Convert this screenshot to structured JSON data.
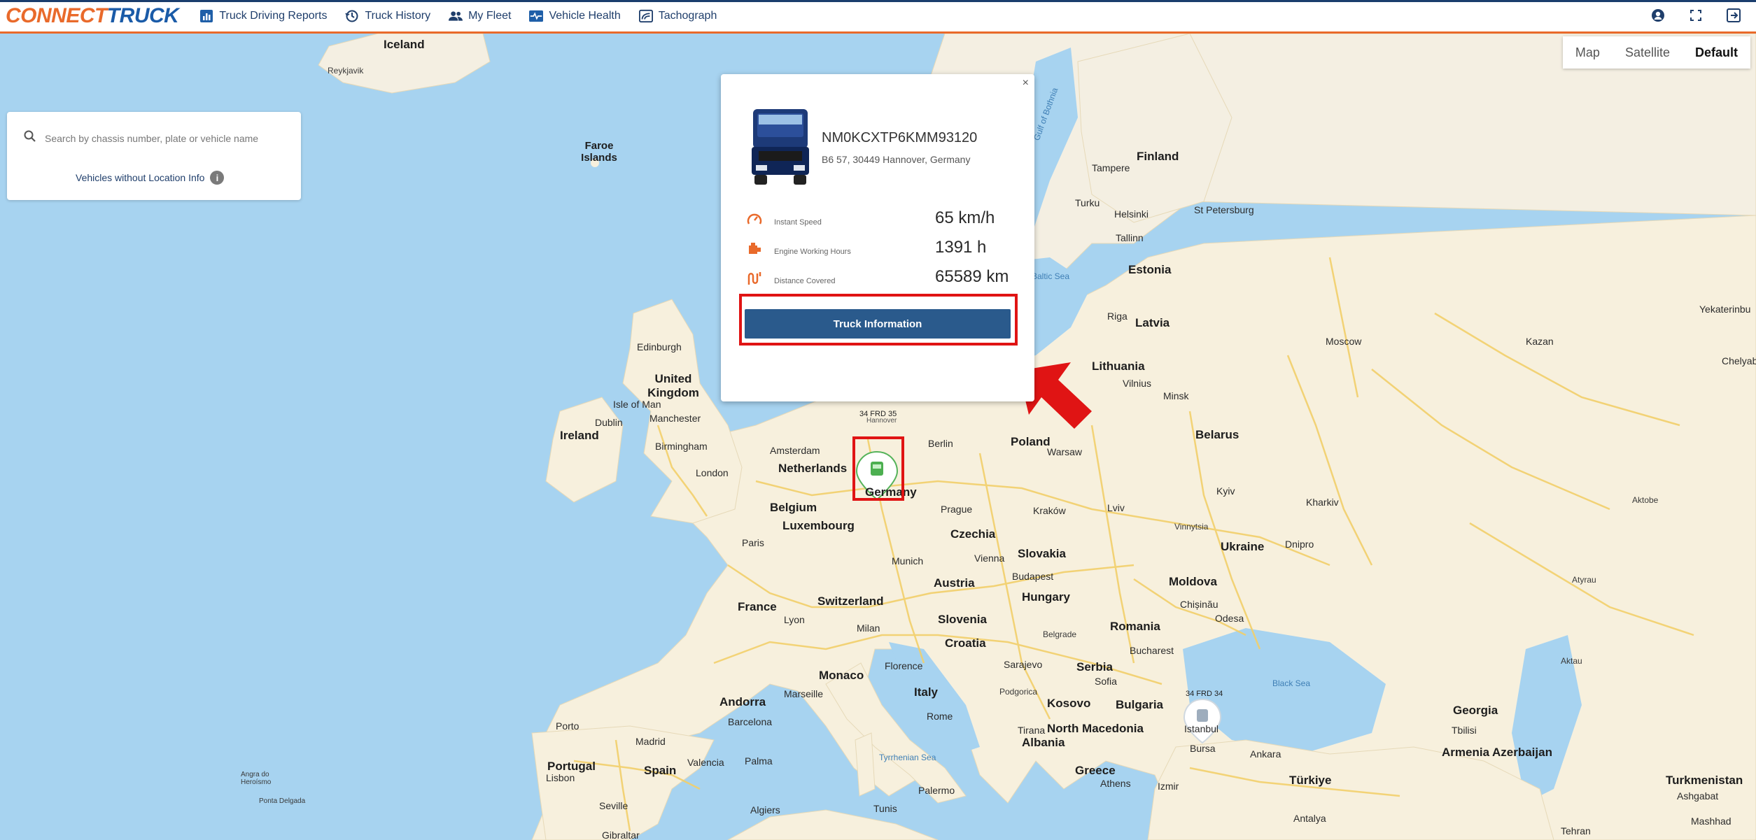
{
  "header": {
    "logo_prefix": "CONNECT",
    "logo_suffix": "RUCK",
    "logo_t": "T",
    "nav": [
      {
        "label": "Truck Driving Reports",
        "icon": "bar-chart-icon"
      },
      {
        "label": "Truck History",
        "icon": "history-icon"
      },
      {
        "label": "My Fleet",
        "icon": "users-icon"
      },
      {
        "label": "Vehicle Health",
        "icon": "heartbeat-icon"
      },
      {
        "label": "Tachograph",
        "icon": "tachograph-icon"
      }
    ],
    "right_icons": [
      "user-icon",
      "fullscreen-icon",
      "logout-icon"
    ]
  },
  "map_type": {
    "options": [
      "Map",
      "Satellite",
      "Default"
    ],
    "selected": "Default"
  },
  "search": {
    "placeholder": "Search by chassis number, plate or vehicle name",
    "value": "",
    "no_location_label": "Vehicles without Location Info"
  },
  "popup": {
    "vin": "NM0KCXTP6KMM93120",
    "address": "B6 57, 30449 Hannover, Germany",
    "stats": [
      {
        "label": "Instant Speed",
        "value": "65 km/h",
        "icon": "speedometer-icon"
      },
      {
        "label": "Engine Working Hours",
        "value": "1391 h",
        "icon": "engine-icon"
      },
      {
        "label": "Distance Covered",
        "value": "65589 km",
        "icon": "route-icon"
      }
    ],
    "button_label": "Truck Information"
  },
  "markers": [
    {
      "plate": "34 FRD 35",
      "sub": "Hannover",
      "status": "active"
    },
    {
      "plate": "34 FRD 34",
      "status": "idle"
    }
  ],
  "map_labels": {
    "countries": [
      "Iceland",
      "Faroe Islands",
      "United Kingdom",
      "Ireland",
      "Netherlands",
      "Belgium",
      "Luxembourg",
      "Germany",
      "France",
      "Switzerland",
      "Austria",
      "Czechia",
      "Poland",
      "Slovakia",
      "Hungary",
      "Slovenia",
      "Croatia",
      "Italy",
      "Monaco",
      "Andorra",
      "Spain",
      "Portugal",
      "Serbia",
      "Bulgaria",
      "Romania",
      "Moldova",
      "Ukraine",
      "Belarus",
      "Lithuania",
      "Latvia",
      "Estonia",
      "Finland",
      "Greece",
      "Albania",
      "North Macedonia",
      "Kosovo",
      "Türkiye",
      "Georgia",
      "Armenia",
      "Azerbaijan",
      "Turkmenistan"
    ],
    "cities": [
      "Reykjavik",
      "Edinburgh",
      "Isle of Man",
      "Manchester",
      "Dublin",
      "Birmingham",
      "London",
      "Amsterdam",
      "Berlin",
      "Warsaw",
      "Prague",
      "Kraków",
      "Munich",
      "Vienna",
      "Budapest",
      "Paris",
      "Lyon",
      "Milan",
      "Marseille",
      "Florence",
      "Rome",
      "Barcelona",
      "Madrid",
      "Valencia",
      "Palma",
      "Lisbon",
      "Porto",
      "Seville",
      "Algiers",
      "Tunis",
      "Palermo",
      "Sarajevo",
      "Sofia",
      "Bucharest",
      "Belgrade",
      "Podgorica",
      "Tirana",
      "Athens",
      "Izmir",
      "Bursa",
      "Ankara",
      "Antalya",
      "Istanbul",
      "Chișinău",
      "Odesa",
      "Kyiv",
      "Kharkiv",
      "Dnipro",
      "Lviv",
      "Vinnytsia",
      "Minsk",
      "Vilnius",
      "Riga",
      "Tallinn",
      "Helsinki",
      "Turku",
      "Tampere",
      "St Petersburg",
      "Moscow",
      "Kazan",
      "Yekaterinbu",
      "Chelyab",
      "Aktobe",
      "Atyrau",
      "Aktau",
      "Tbilisi",
      "Ashgabat",
      "Mashhad",
      "Tehran",
      "Gibraltar",
      "Angra do Heroísmo",
      "Ponta Delgada"
    ],
    "seas": [
      "Black Sea",
      "Tyrrhenian Sea",
      "Baltic Sea",
      "Gulf of Bothnia"
    ]
  },
  "colors": {
    "accent": "#e96a2b",
    "brand": "#1a5ba8",
    "button": "#2a5a8c",
    "highlight": "#e01414",
    "marker": "#4caf50"
  }
}
